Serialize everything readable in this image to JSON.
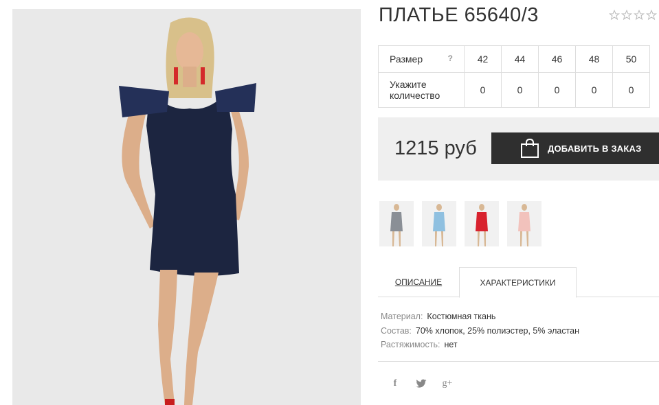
{
  "product": {
    "title": "ПЛАТЬЕ 65640/3",
    "rating_icon": "star-outline-icon"
  },
  "sizes": {
    "size_label": "Размер",
    "help": "?",
    "qty_label": "Укажите количество",
    "values": [
      "42",
      "44",
      "46",
      "48",
      "50"
    ],
    "quantities": [
      "0",
      "0",
      "0",
      "0",
      "0"
    ]
  },
  "price": {
    "value": "1215 руб"
  },
  "order": {
    "label": "ДОБАВИТЬ В ЗАКАЗ",
    "icon": "shopping-bag-icon"
  },
  "thumbnails": [
    {
      "color": "#8a8f96"
    },
    {
      "color": "#8fc0e0"
    },
    {
      "color": "#d8222e"
    },
    {
      "color": "#f2c2bc"
    }
  ],
  "tabs": {
    "description": "ОПИСАНИЕ",
    "characteristics": "ХАРАКТЕРИСТИКИ"
  },
  "props": [
    {
      "key": "Материал:",
      "value": "Костюмная ткань"
    },
    {
      "key": "Состав:",
      "value": "70% хлопок, 25% полиэстер, 5% эластан"
    },
    {
      "key": "Растяжимость:",
      "value": "нет"
    }
  ],
  "social": {
    "facebook": "f",
    "google": "g+"
  },
  "colors": {
    "dark_button": "#2f2f2f",
    "price_bg": "#efefef",
    "dress": "#1c2540"
  }
}
